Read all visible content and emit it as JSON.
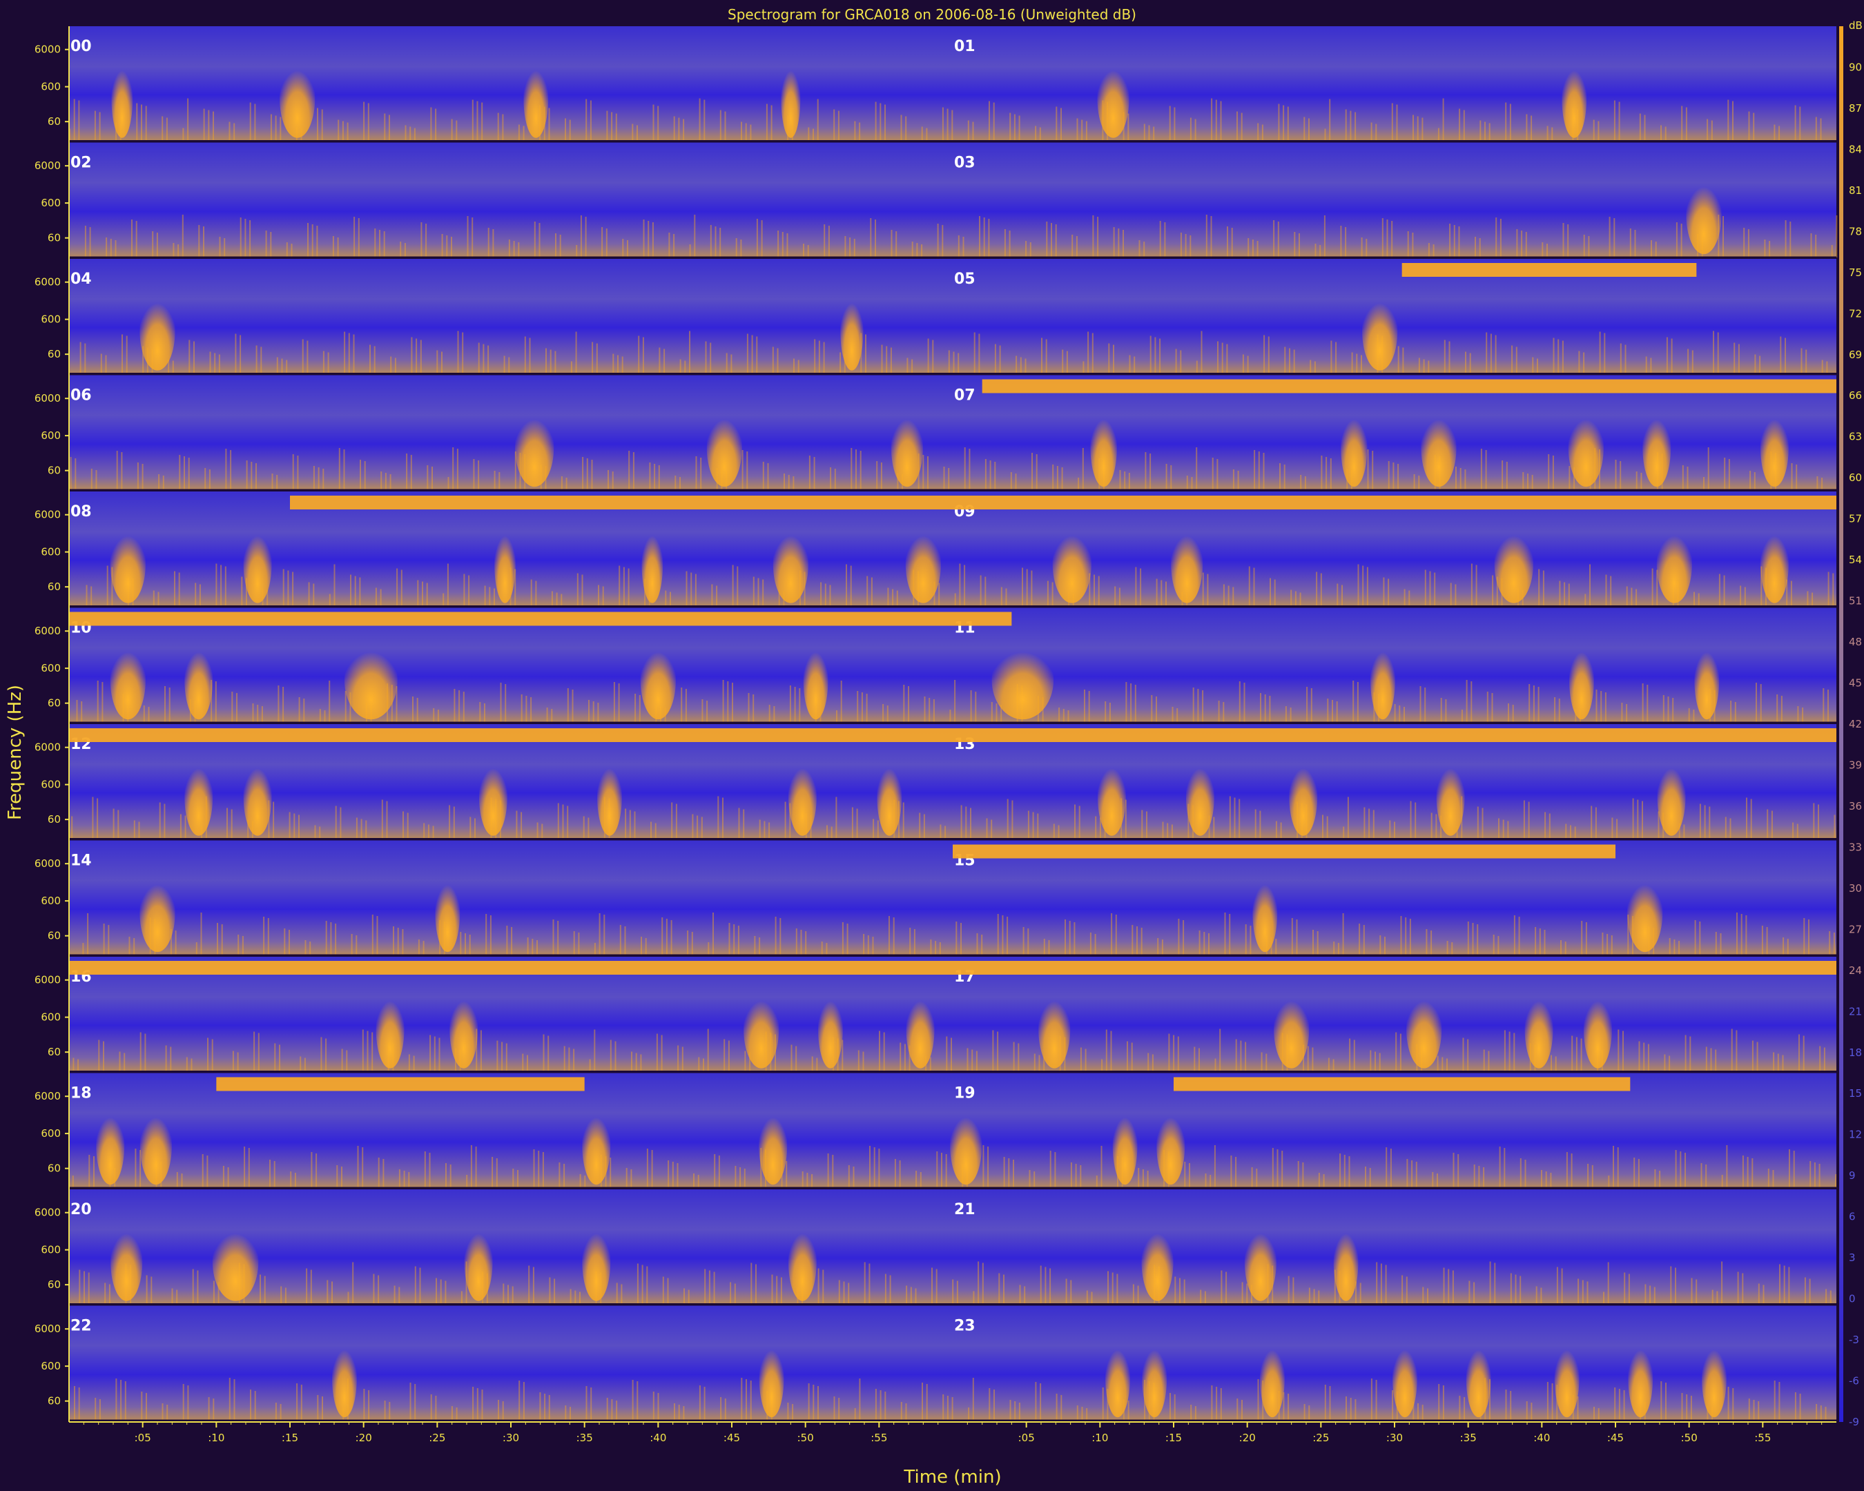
{
  "chart_data": {
    "type": "heatmap",
    "title": "Spectrogram for  GRCA018 on 2006-08-16 (Unweighted dB)",
    "xlabel": "Time (min)",
    "ylabel": "Frequency (Hz)",
    "y_tick_labels": [
      "60",
      "600",
      "6000"
    ],
    "y_scale": "log",
    "x_tick_labels": [
      ":05",
      ":10",
      ":15",
      ":20",
      ":25",
      ":30",
      ":35",
      ":40",
      ":45",
      ":50",
      ":55"
    ],
    "hour_labels": [
      "00",
      "01",
      "02",
      "03",
      "04",
      "05",
      "06",
      "07",
      "08",
      "09",
      "10",
      "11",
      "12",
      "13",
      "14",
      "15",
      "16",
      "17",
      "18",
      "19",
      "20",
      "21",
      "22",
      "23"
    ],
    "colorbar": {
      "unit": "dB",
      "ticks": [
        90,
        87,
        84,
        81,
        78,
        75,
        72,
        69,
        66,
        63,
        60,
        57,
        54,
        51,
        48,
        45,
        42,
        39,
        36,
        33,
        30,
        27,
        24,
        21,
        18,
        15,
        12,
        9,
        6,
        3,
        0,
        -3,
        -6,
        -9
      ]
    },
    "colors": {
      "background": "#1b0a33",
      "low": "#2a1fd6",
      "mid": "#8a6fa8",
      "high": "#f5a623",
      "axis": "#f2e34a"
    },
    "events": [
      {
        "hour": 0,
        "min": 3.0,
        "width": 1.2
      },
      {
        "hour": 0,
        "min": 14.5,
        "width": 2.0
      },
      {
        "hour": 0,
        "min": 31.0,
        "width": 1.4
      },
      {
        "hour": 0,
        "min": 48.5,
        "width": 1.0
      },
      {
        "hour": 1,
        "min": 10.0,
        "width": 1.8
      },
      {
        "hour": 1,
        "min": 41.5,
        "width": 1.4
      },
      {
        "hour": 3,
        "min": 50.0,
        "width": 2.0
      },
      {
        "hour": 4,
        "min": 5.0,
        "width": 2.0
      },
      {
        "hour": 4,
        "min": 52.5,
        "width": 1.3
      },
      {
        "hour": 5,
        "min": 28.0,
        "width": 2.0
      },
      {
        "hour": 6,
        "min": 30.5,
        "width": 2.2
      },
      {
        "hour": 6,
        "min": 43.5,
        "width": 2.0
      },
      {
        "hour": 6,
        "min": 56.0,
        "width": 1.8
      },
      {
        "hour": 7,
        "min": 9.5,
        "width": 1.5
      },
      {
        "hour": 7,
        "min": 26.5,
        "width": 1.5
      },
      {
        "hour": 7,
        "min": 32.0,
        "width": 2.0
      },
      {
        "hour": 7,
        "min": 42.0,
        "width": 2.0
      },
      {
        "hour": 7,
        "min": 47.0,
        "width": 1.6
      },
      {
        "hour": 7,
        "min": 55.0,
        "width": 1.6
      },
      {
        "hour": 8,
        "min": 3.0,
        "width": 2.0
      },
      {
        "hour": 8,
        "min": 12.0,
        "width": 1.6
      },
      {
        "hour": 8,
        "min": 29.0,
        "width": 1.2
      },
      {
        "hour": 8,
        "min": 39.0,
        "width": 1.2
      },
      {
        "hour": 8,
        "min": 48.0,
        "width": 2.0
      },
      {
        "hour": 8,
        "min": 57.0,
        "width": 2.0
      },
      {
        "hour": 9,
        "min": 7.0,
        "width": 2.2
      },
      {
        "hour": 9,
        "min": 15.0,
        "width": 1.8
      },
      {
        "hour": 9,
        "min": 37.0,
        "width": 2.2
      },
      {
        "hour": 9,
        "min": 48.0,
        "width": 2.0
      },
      {
        "hour": 9,
        "min": 55.0,
        "width": 1.6
      },
      {
        "hour": 10,
        "min": 3.0,
        "width": 2.0
      },
      {
        "hour": 10,
        "min": 8.0,
        "width": 1.6
      },
      {
        "hour": 10,
        "min": 19.0,
        "width": 3.0
      },
      {
        "hour": 10,
        "min": 39.0,
        "width": 2.0
      },
      {
        "hour": 10,
        "min": 50.0,
        "width": 1.4
      },
      {
        "hour": 11,
        "min": 3.0,
        "width": 3.5
      },
      {
        "hour": 11,
        "min": 28.5,
        "width": 1.4
      },
      {
        "hour": 11,
        "min": 42.0,
        "width": 1.4
      },
      {
        "hour": 11,
        "min": 50.5,
        "width": 1.4
      },
      {
        "hour": 12,
        "min": 8.0,
        "width": 1.6
      },
      {
        "hour": 12,
        "min": 12.0,
        "width": 1.6
      },
      {
        "hour": 12,
        "min": 28.0,
        "width": 1.6
      },
      {
        "hour": 12,
        "min": 36.0,
        "width": 1.4
      },
      {
        "hour": 12,
        "min": 49.0,
        "width": 1.6
      },
      {
        "hour": 12,
        "min": 55.0,
        "width": 1.4
      },
      {
        "hour": 13,
        "min": 10.0,
        "width": 1.6
      },
      {
        "hour": 13,
        "min": 16.0,
        "width": 1.6
      },
      {
        "hour": 13,
        "min": 23.0,
        "width": 1.6
      },
      {
        "hour": 13,
        "min": 33.0,
        "width": 1.6
      },
      {
        "hour": 13,
        "min": 48.0,
        "width": 1.6
      },
      {
        "hour": 14,
        "min": 5.0,
        "width": 2.0
      },
      {
        "hour": 14,
        "min": 25.0,
        "width": 1.4
      },
      {
        "hour": 15,
        "min": 20.5,
        "width": 1.4
      },
      {
        "hour": 15,
        "min": 46.0,
        "width": 2.0
      },
      {
        "hour": 16,
        "min": 21.0,
        "width": 1.6
      },
      {
        "hour": 16,
        "min": 26.0,
        "width": 1.6
      },
      {
        "hour": 16,
        "min": 46.0,
        "width": 2.0
      },
      {
        "hour": 16,
        "min": 51.0,
        "width": 1.4
      },
      {
        "hour": 16,
        "min": 57.0,
        "width": 1.6
      },
      {
        "hour": 17,
        "min": 6.0,
        "width": 1.8
      },
      {
        "hour": 17,
        "min": 22.0,
        "width": 2.0
      },
      {
        "hour": 17,
        "min": 31.0,
        "width": 2.0
      },
      {
        "hour": 17,
        "min": 39.0,
        "width": 1.6
      },
      {
        "hour": 17,
        "min": 43.0,
        "width": 1.6
      },
      {
        "hour": 18,
        "min": 2.0,
        "width": 1.6
      },
      {
        "hour": 18,
        "min": 5.0,
        "width": 1.8
      },
      {
        "hour": 18,
        "min": 35.0,
        "width": 1.6
      },
      {
        "hour": 18,
        "min": 47.0,
        "width": 1.6
      },
      {
        "hour": 19,
        "min": 0.0,
        "width": 1.8
      },
      {
        "hour": 19,
        "min": 11.0,
        "width": 1.4
      },
      {
        "hour": 19,
        "min": 14.0,
        "width": 1.6
      },
      {
        "hour": 20,
        "min": 3.0,
        "width": 1.8
      },
      {
        "hour": 20,
        "min": 10.0,
        "width": 2.6
      },
      {
        "hour": 20,
        "min": 27.0,
        "width": 1.6
      },
      {
        "hour": 20,
        "min": 35.0,
        "width": 1.6
      },
      {
        "hour": 20,
        "min": 49.0,
        "width": 1.6
      },
      {
        "hour": 21,
        "min": 13.0,
        "width": 1.8
      },
      {
        "hour": 21,
        "min": 20.0,
        "width": 1.8
      },
      {
        "hour": 21,
        "min": 26.0,
        "width": 1.4
      },
      {
        "hour": 22,
        "min": 18.0,
        "width": 1.4
      },
      {
        "hour": 22,
        "min": 47.0,
        "width": 1.4
      },
      {
        "hour": 23,
        "min": 10.5,
        "width": 1.4
      },
      {
        "hour": 23,
        "min": 13.0,
        "width": 1.4
      },
      {
        "hour": 23,
        "min": 21.0,
        "width": 1.4
      },
      {
        "hour": 23,
        "min": 30.0,
        "width": 1.4
      },
      {
        "hour": 23,
        "min": 35.0,
        "width": 1.4
      },
      {
        "hour": 23,
        "min": 41.0,
        "width": 1.4
      },
      {
        "hour": 23,
        "min": 46.0,
        "width": 1.4
      },
      {
        "hour": 23,
        "min": 51.0,
        "width": 1.4
      }
    ],
    "tones": [
      {
        "hour": 5,
        "from": 30.5,
        "to": 50.5
      },
      {
        "hour": 7,
        "from": 2.0,
        "to": 60.0
      },
      {
        "hour": 8,
        "from": 15.0,
        "to": 60.0
      },
      {
        "hour": 9,
        "from": 0.0,
        "to": 60.0
      },
      {
        "hour": 10,
        "from": 0.0,
        "to": 60.0
      },
      {
        "hour": 11,
        "from": 0.0,
        "to": 4.0
      },
      {
        "hour": 12,
        "from": 0.0,
        "to": 60.0
      },
      {
        "hour": 13,
        "from": 0.0,
        "to": 60.0
      },
      {
        "hour": 15,
        "from": 0.0,
        "to": 45.0
      },
      {
        "hour": 16,
        "from": 0.0,
        "to": 60.0
      },
      {
        "hour": 17,
        "from": 0.0,
        "to": 60.0
      },
      {
        "hour": 18,
        "from": 10.0,
        "to": 35.0
      },
      {
        "hour": 19,
        "from": 15.0,
        "to": 46.0
      }
    ]
  }
}
